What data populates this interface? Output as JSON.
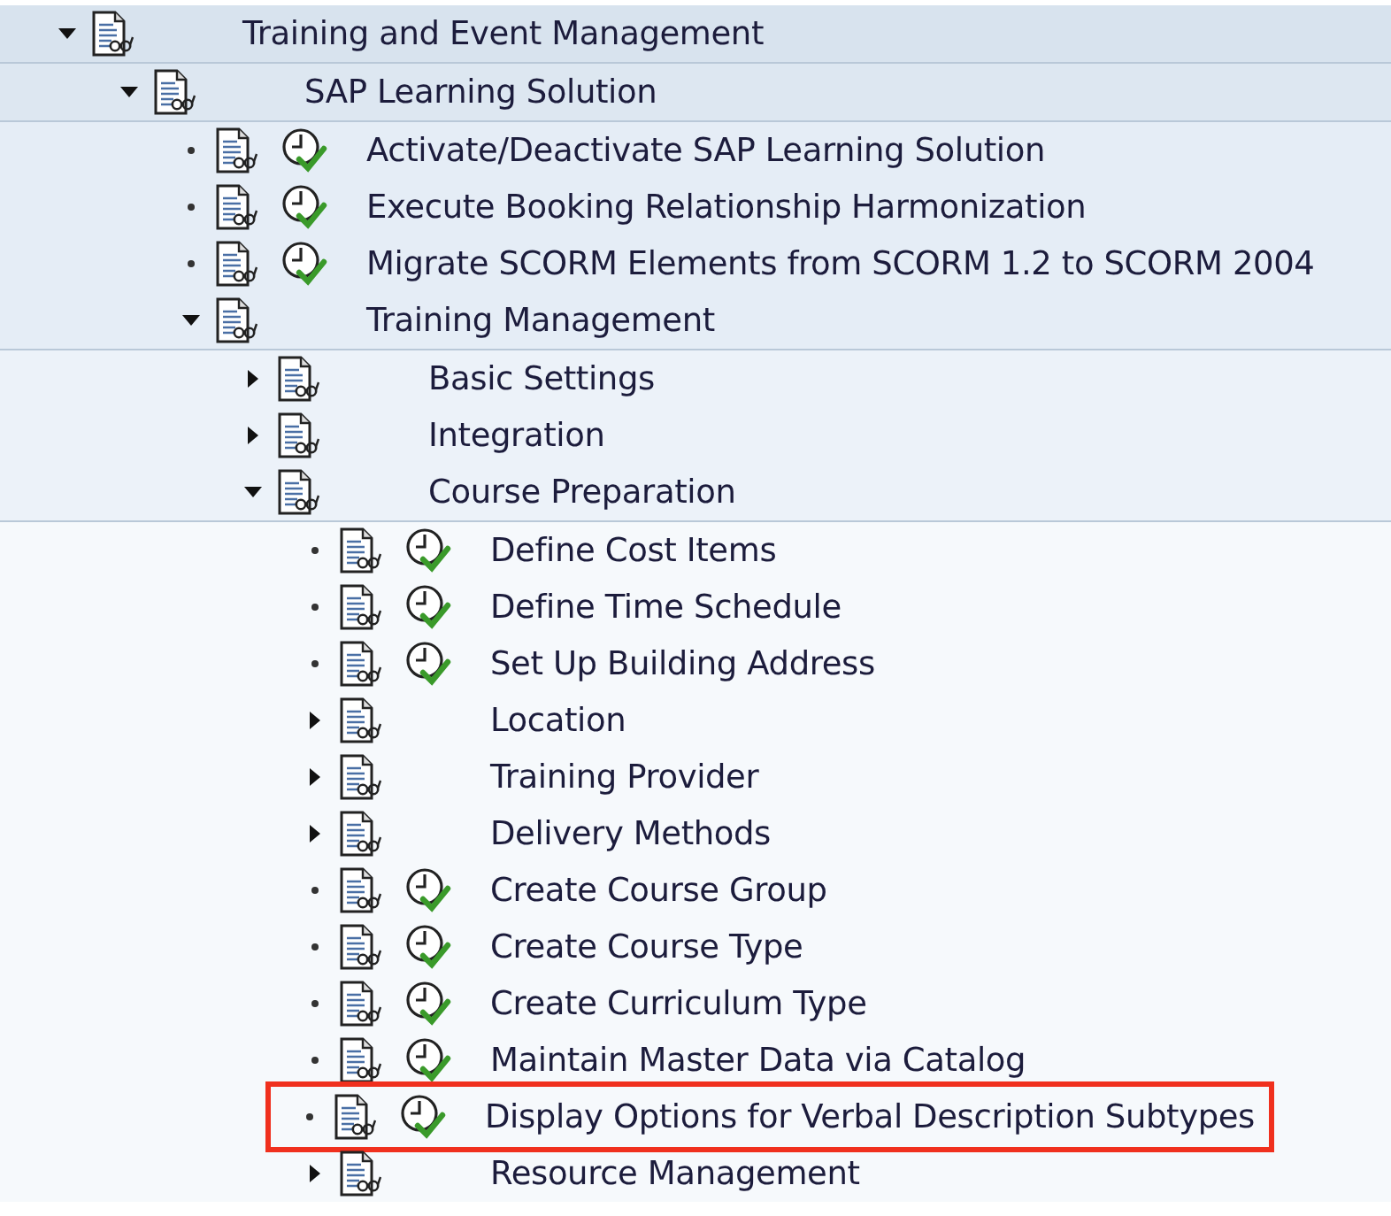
{
  "tree": [
    {
      "kind": "folder",
      "label": "Training and Event Management",
      "expanded": true,
      "children": [
        {
          "kind": "folder",
          "label": "SAP Learning Solution",
          "expanded": true,
          "children": [
            {
              "kind": "activity",
              "label": "Activate/Deactivate SAP Learning Solution"
            },
            {
              "kind": "activity",
              "label": "Execute Booking Relationship Harmonization"
            },
            {
              "kind": "activity",
              "label": "Migrate SCORM Elements from SCORM 1.2 to SCORM 2004"
            },
            {
              "kind": "folder",
              "label": "Training Management",
              "expanded": true,
              "children": [
                {
                  "kind": "folder",
                  "label": "Basic Settings",
                  "expanded": false
                },
                {
                  "kind": "folder",
                  "label": "Integration",
                  "expanded": false
                },
                {
                  "kind": "folder",
                  "label": "Course Preparation",
                  "expanded": true,
                  "children": [
                    {
                      "kind": "activity",
                      "label": "Define Cost Items",
                      "highlighted": false
                    },
                    {
                      "kind": "activity",
                      "label": "Define Time Schedule",
                      "highlighted": false
                    },
                    {
                      "kind": "activity",
                      "label": "Set Up Building Address",
                      "highlighted": false
                    },
                    {
                      "kind": "folder",
                      "label": "Location",
                      "expanded": false,
                      "highlighted": false
                    },
                    {
                      "kind": "folder",
                      "label": "Training Provider",
                      "expanded": false,
                      "highlighted": false
                    },
                    {
                      "kind": "folder",
                      "label": "Delivery Methods",
                      "expanded": false,
                      "highlighted": false
                    },
                    {
                      "kind": "activity",
                      "label": "Create Course Group",
                      "highlighted": false
                    },
                    {
                      "kind": "activity",
                      "label": "Create Course Type",
                      "highlighted": false
                    },
                    {
                      "kind": "activity",
                      "label": "Create Curriculum Type",
                      "highlighted": false
                    },
                    {
                      "kind": "activity",
                      "label": "Maintain Master Data via Catalog",
                      "highlighted": false
                    },
                    {
                      "kind": "activity",
                      "label": "Display Options for Verbal Description Subtypes",
                      "highlighted": true
                    },
                    {
                      "kind": "folder",
                      "label": "Resource Management",
                      "expanded": false,
                      "highlighted": false
                    }
                  ]
                }
              ]
            }
          ]
        }
      ]
    }
  ]
}
